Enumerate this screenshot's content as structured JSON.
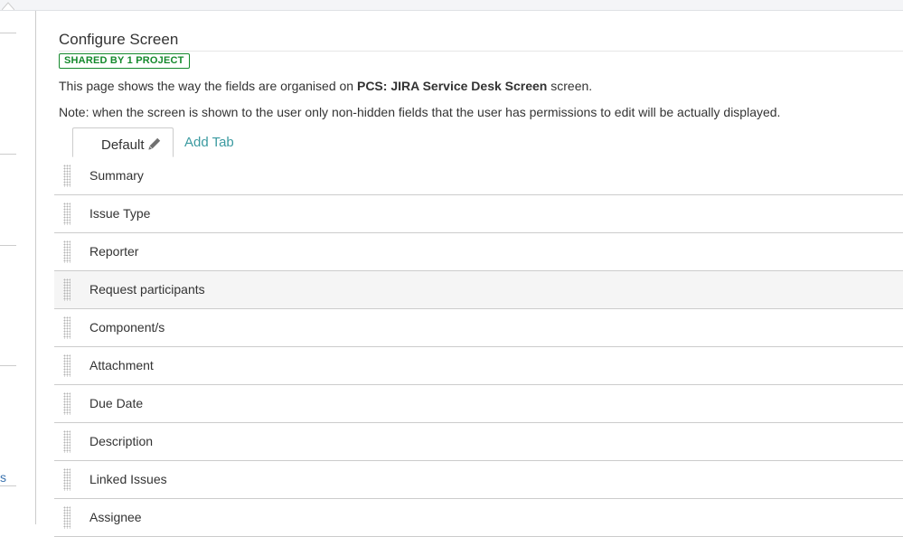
{
  "page": {
    "title": "Configure Screen",
    "shared_badge_prefix": "SHARED BY",
    "shared_badge_count": "1",
    "shared_badge_suffix": "PROJECT",
    "description_prefix": "This page shows the way the fields are organised on",
    "screen_name": "PCS: JIRA Service Desk Screen",
    "description_suffix": "screen.",
    "note": "Note: when the screen is shown to the user only non-hidden fields that the user has permissions to edit will be actually displayed."
  },
  "tabs": {
    "active_label": "Default",
    "edit_icon": "pencil-icon",
    "add_label": "Add Tab"
  },
  "fields": [
    {
      "label": "Summary"
    },
    {
      "label": "Issue Type"
    },
    {
      "label": "Reporter"
    },
    {
      "label": "Request participants"
    },
    {
      "label": "Component/s"
    },
    {
      "label": "Attachment"
    },
    {
      "label": "Due Date"
    },
    {
      "label": "Description"
    },
    {
      "label": "Linked Issues"
    },
    {
      "label": "Assignee"
    }
  ],
  "sidebar": {
    "snippet": "s"
  },
  "colors": {
    "badge": "#14892c",
    "link": "#3b9aa0",
    "hover_row": "#f5f5f5",
    "border": "#cccccc"
  }
}
